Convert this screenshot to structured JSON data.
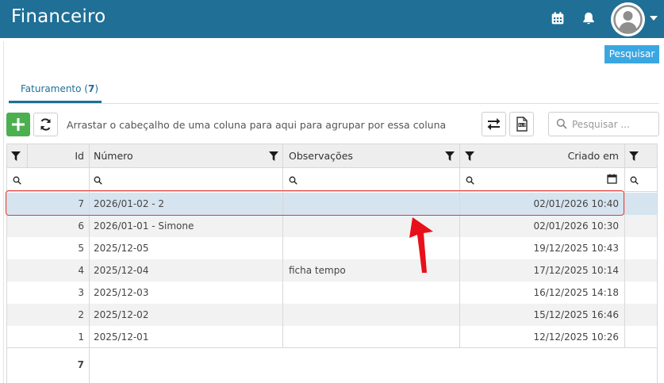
{
  "header": {
    "title": "Financeiro",
    "icons": [
      "calendar-icon",
      "bell-icon",
      "user-avatar-icon",
      "caret-down-icon"
    ]
  },
  "toolbar_top": {
    "search_label": "Pesquisar"
  },
  "tabs": [
    {
      "label": "Faturamento",
      "count": "7"
    }
  ],
  "grid_toolbar": {
    "group_hint": "Arrastar o cabeçalho de uma coluna para aqui para agrupar por essa coluna",
    "search_placeholder": "Pesquisar ..."
  },
  "columns": {
    "id": "Id",
    "numero": "Número",
    "observacoes": "Observações",
    "criado_em": "Criado em"
  },
  "rows": [
    {
      "id": "7",
      "numero": "2026/01-02 - 2",
      "observacoes": "",
      "criado_em": "02/01/2026 10:40"
    },
    {
      "id": "6",
      "numero": "2026/01-01 - Simone",
      "observacoes": "",
      "criado_em": "02/01/2026 10:30"
    },
    {
      "id": "5",
      "numero": "2025/12-05",
      "observacoes": "",
      "criado_em": "19/12/2025 10:43"
    },
    {
      "id": "4",
      "numero": "2025/12-04",
      "observacoes": "ficha tempo",
      "criado_em": "17/12/2025 10:14"
    },
    {
      "id": "3",
      "numero": "2025/12-03",
      "observacoes": "",
      "criado_em": "16/12/2025 14:18"
    },
    {
      "id": "2",
      "numero": "2025/12-02",
      "observacoes": "",
      "criado_em": "15/12/2025 16:46"
    },
    {
      "id": "1",
      "numero": "2025/12-01",
      "observacoes": "",
      "criado_em": "12/12/2025 10:26"
    }
  ],
  "footer": {
    "count": "7"
  },
  "colors": {
    "header_bg": "#1f6f96",
    "search_button": "#3aa7e3",
    "add_button": "#4caf50",
    "selected_row": "#d6e4f0",
    "highlight": "#e53935"
  }
}
